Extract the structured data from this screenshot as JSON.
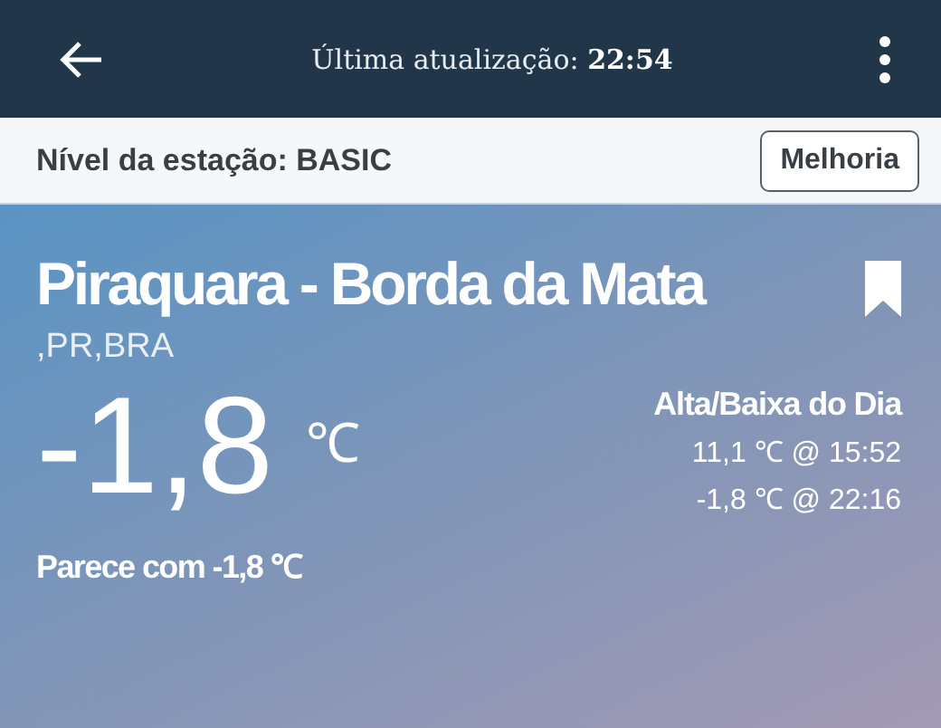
{
  "header": {
    "title": "Última atualização: **22:54**"
  },
  "station": {
    "level_label": "Nível da estação: BASIC",
    "upgrade_button": "Melhoria"
  },
  "location": {
    "name": "Piraquara - Borda da Mata",
    "region": ",PR,BRA"
  },
  "current": {
    "temperature": "-1,8",
    "unit": "℃",
    "feels_like": "Parece com -1,8 ℃"
  },
  "high_low": {
    "title": "Alta/Baixa do Dia",
    "high": "11,1 ℃ @ 15:52",
    "low": "-1,8 ℃ @ 22:16"
  }
}
